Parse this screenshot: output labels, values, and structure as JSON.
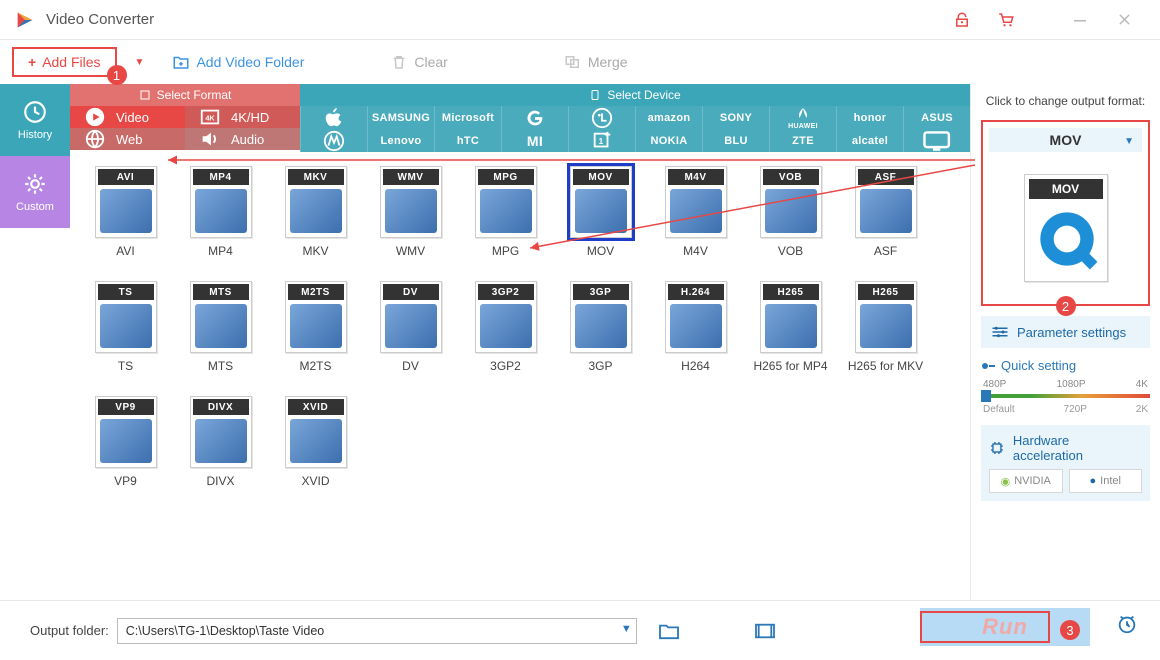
{
  "app_title": "Video Converter",
  "toolbar": {
    "add_files": "Add Files",
    "add_folder": "Add Video Folder",
    "clear": "Clear",
    "merge": "Merge"
  },
  "sidebar": {
    "history": "History",
    "custom": "Custom"
  },
  "section": {
    "select_format": "Select Format",
    "select_device": "Select Device"
  },
  "categories": {
    "video": "Video",
    "hd": "4K/HD",
    "web": "Web",
    "audio": "Audio"
  },
  "brands": {
    "row1": [
      "Apple",
      "SAMSUNG",
      "Microsoft",
      "Google",
      "LG",
      "amazon",
      "SONY",
      "HUAWEI",
      "honor",
      "ASUS"
    ],
    "row2": [
      "Motorola",
      "Lenovo",
      "hTC",
      "Xiaomi",
      "OnePlus",
      "NOKIA",
      "BLU",
      "ZTE",
      "alcatel",
      "TV"
    ]
  },
  "formats": [
    "AVI",
    "MP4",
    "MKV",
    "WMV",
    "MPG",
    "MOV",
    "M4V",
    "VOB",
    "ASF",
    "TS",
    "MTS",
    "M2TS",
    "DV",
    "3GP2",
    "3GP",
    "H264",
    "H265 for MP4",
    "H265 for MKV",
    "VP9",
    "DIVX",
    "XVID"
  ],
  "format_tile_labels": {
    "H264": "H.264",
    "H265 for MP4": "H265",
    "H265 for MKV": "H265",
    "DIVX": "DIVX",
    "XVID": "XVID"
  },
  "selected_format": "MOV",
  "right": {
    "hint": "Click to change output format:",
    "current": "MOV",
    "param": "Parameter settings",
    "quick": "Quick setting",
    "marks_top": [
      "480P",
      "1080P",
      "4K"
    ],
    "marks_bottom": [
      "Default",
      "720P",
      "2K"
    ],
    "hw": "Hardware acceleration",
    "nvidia": "NVIDIA",
    "intel": "Intel"
  },
  "bottom": {
    "label": "Output folder:",
    "path": "C:\\Users\\TG-1\\Desktop\\Taste Video",
    "run": "Run"
  },
  "callouts": {
    "c1": "1",
    "c2": "2",
    "c3": "3"
  }
}
